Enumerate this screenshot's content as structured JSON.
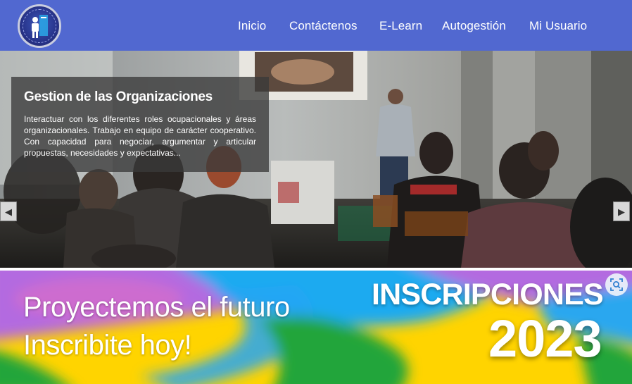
{
  "header": {
    "logo_icon": "institution-logo-icon",
    "nav": [
      {
        "label": "Inicio"
      },
      {
        "label": "Contáctenos"
      },
      {
        "label": "E-Learn"
      },
      {
        "label": "Autogestión"
      },
      {
        "label": "Mi Usuario"
      }
    ]
  },
  "slider": {
    "photo": "classroom-presentation-photo",
    "caption": {
      "title": "Gestion de las Organizaciones",
      "text": "Interactuar con los diferentes roles ocupacionales y áreas organizacionales. Trabajo en equipo de carácter cooperativo. Con capacidad para negociar, argumentar y articular propuestas, necesidades y expectativas..."
    },
    "prev_icon": "prev-arrow-icon",
    "next_icon": "next-arrow-icon",
    "prev_glyph": "◀",
    "next_glyph": "▶"
  },
  "banner": {
    "line1": "Proyectemos el futuro",
    "line2": "Inscribite hoy!",
    "heading": "INSCRIPCIONES",
    "year": "2023",
    "colors": {
      "yellow": "#ffd400",
      "purple": "#b36be0",
      "cyan": "#1aaaf0",
      "green": "#24a53a"
    }
  },
  "overlay": {
    "scan_icon": "visual-search-icon"
  }
}
